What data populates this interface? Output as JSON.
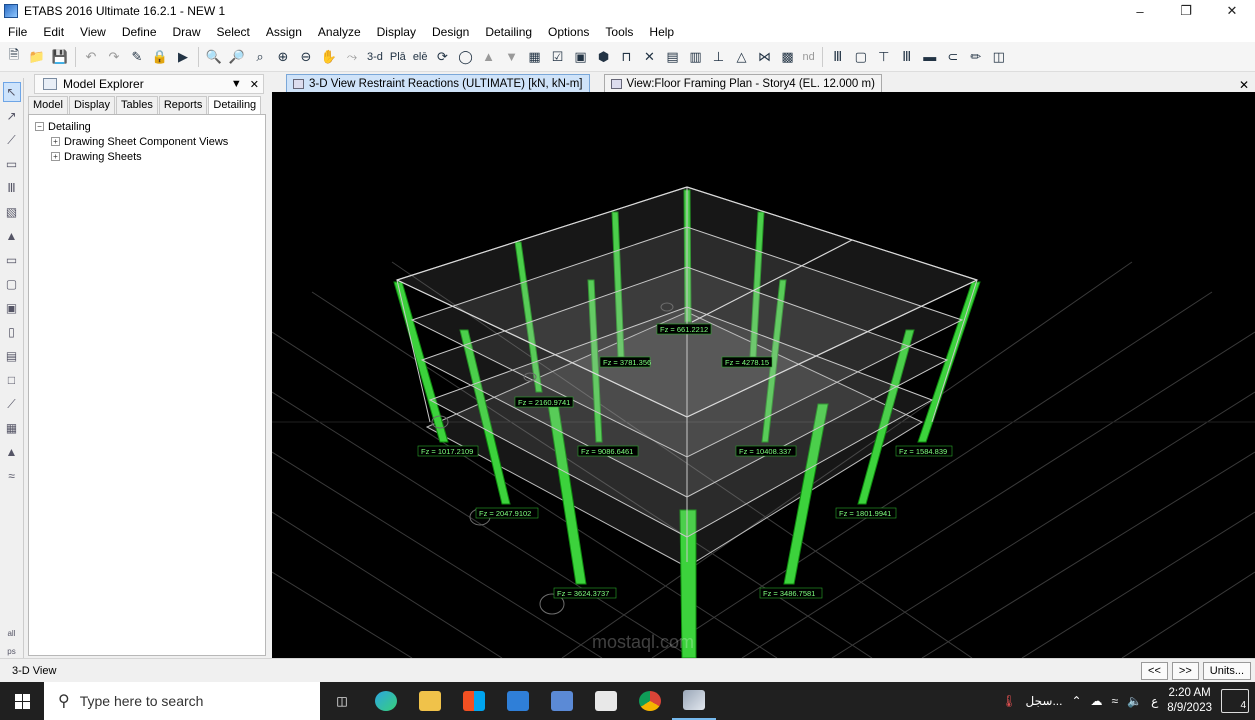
{
  "window": {
    "title": "ETABS 2016 Ultimate 16.2.1 - NEW 1"
  },
  "menu": [
    "File",
    "Edit",
    "View",
    "Define",
    "Draw",
    "Select",
    "Assign",
    "Analyze",
    "Display",
    "Design",
    "Detailing",
    "Options",
    "Tools",
    "Help"
  ],
  "toolbar": {
    "view_3d_label": "3-d",
    "plan_label": "Plā",
    "elev_label": "elē",
    "nd_label": "nd"
  },
  "explorer": {
    "title": "Model Explorer",
    "tabs": [
      "Model",
      "Display",
      "Tables",
      "Reports",
      "Detailing"
    ],
    "active_tab": "Detailing",
    "tree": {
      "root": "Detailing",
      "children": [
        "Drawing Sheet Component Views",
        "Drawing Sheets"
      ]
    }
  },
  "document_tabs": [
    {
      "label": "3-D View   Restraint Reactions   (ULTIMATE)  [kN, kN-m]",
      "active": true
    },
    {
      "label": "View:Floor Framing Plan - Story4 (EL. 12.000 m)",
      "active": false
    }
  ],
  "reactions": {
    "r1": "Fz = 661.2212",
    "r2": "Fz = 3781.356",
    "r3": "Fz = 4278.15",
    "r4": "Fz = 2160.9741",
    "r5": "Fz = 1017.2109",
    "r6": "Fz = 9086.6461",
    "r7": "Fz = 10408.337",
    "r8": "Fz = 1584.839",
    "r9": "Fz = 2047.9102",
    "r10": "Fz = 1801.9941",
    "r11": "Fz = 3624.3737",
    "r12": "Fz = 3486.7581"
  },
  "colors": {
    "column": "#3cd23c",
    "label_text": "#7dff7d",
    "grid": "#3a3a3a",
    "slab": "#9a9a9a"
  },
  "statusbar": {
    "text": "3-D View",
    "prev": "<<",
    "next": ">>",
    "units": "Units..."
  },
  "taskbar": {
    "search_placeholder": "Type here to search",
    "weather": "سجل...",
    "lang": "ع",
    "time": "2:20 AM",
    "date": "8/9/2023",
    "notifications": "4"
  },
  "watermark": "mostaql.com"
}
